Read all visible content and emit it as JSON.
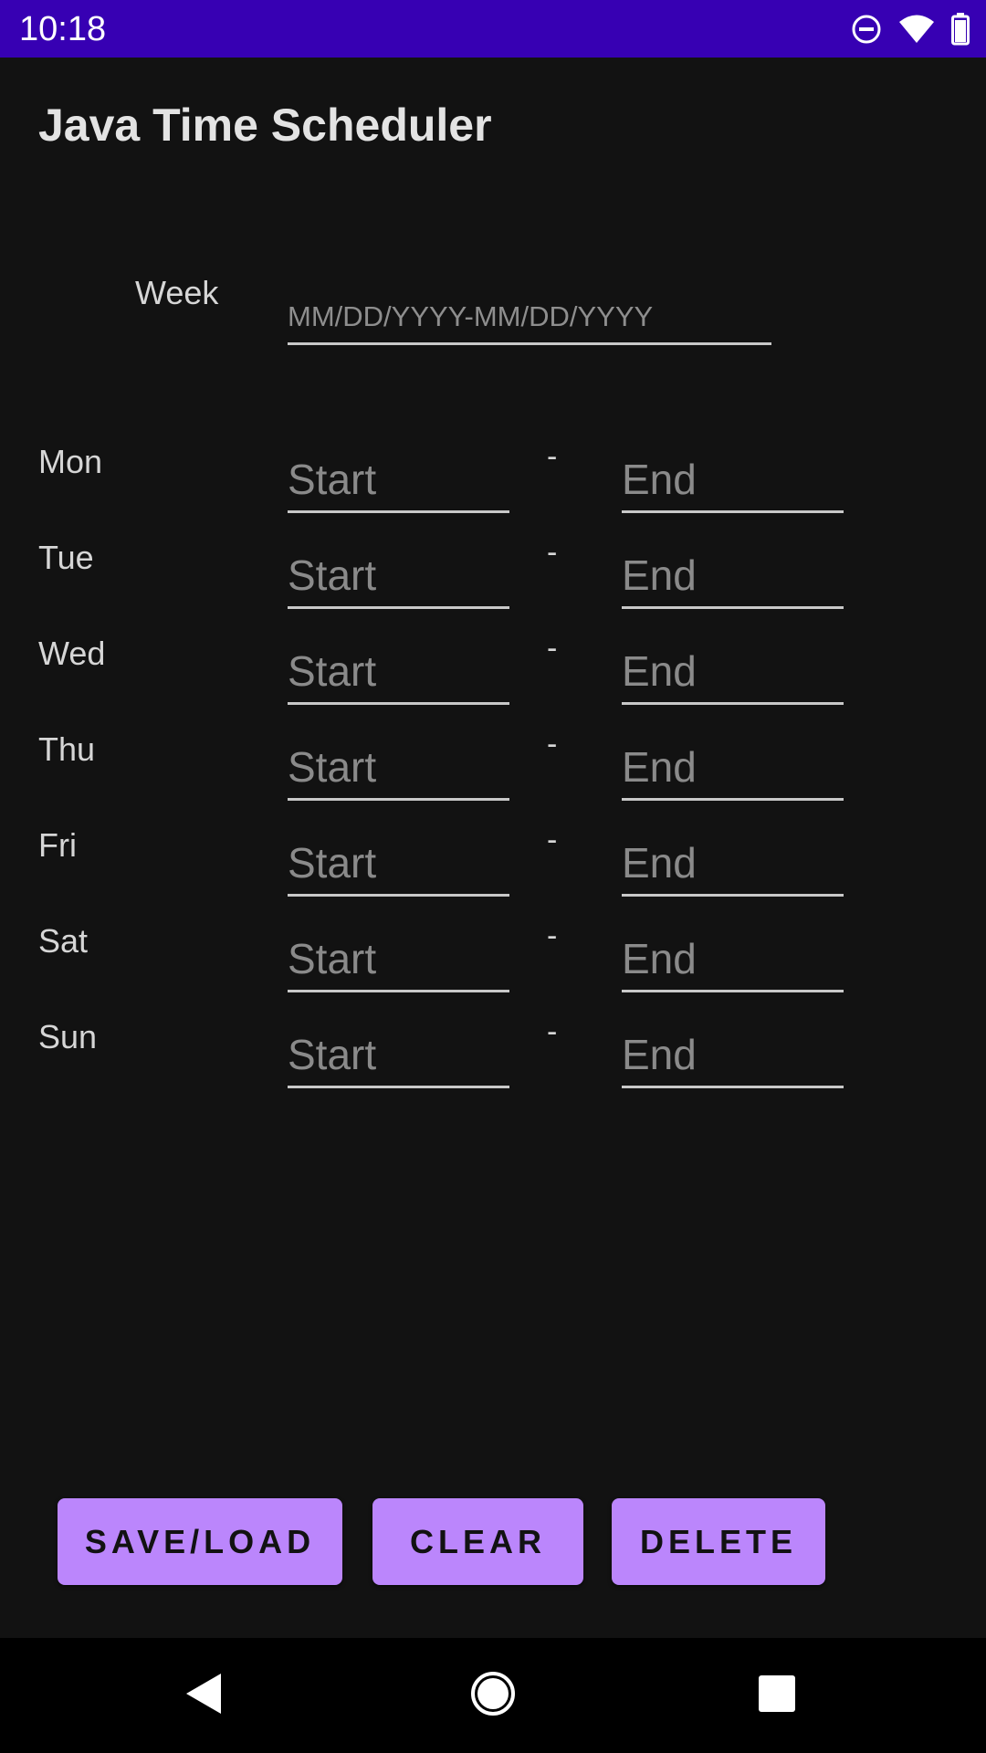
{
  "status_bar": {
    "time": "10:18",
    "icons": [
      "do-not-disturb-icon",
      "wifi-icon",
      "battery-icon"
    ],
    "background": "#3700b3"
  },
  "app": {
    "title": "Java Time Scheduler"
  },
  "week": {
    "label": "Week",
    "value": "",
    "placeholder": "MM/DD/YYYY-MM/DD/YYYY"
  },
  "days": [
    {
      "label": "Mon",
      "start_placeholder": "Start",
      "separator": "-",
      "end_placeholder": "End"
    },
    {
      "label": "Tue",
      "start_placeholder": "Start",
      "separator": "-",
      "end_placeholder": "End"
    },
    {
      "label": "Wed",
      "start_placeholder": "Start",
      "separator": "-",
      "end_placeholder": "End"
    },
    {
      "label": "Thu",
      "start_placeholder": "Start",
      "separator": "-",
      "end_placeholder": "End"
    },
    {
      "label": "Fri",
      "start_placeholder": "Start",
      "separator": "-",
      "end_placeholder": "End"
    },
    {
      "label": "Sat",
      "start_placeholder": "Start",
      "separator": "-",
      "end_placeholder": "End"
    },
    {
      "label": "Sun",
      "start_placeholder": "Start",
      "separator": "-",
      "end_placeholder": "End"
    }
  ],
  "buttons": {
    "save_load": "SAVE/LOAD",
    "clear": "CLEAR",
    "delete": "DELETE",
    "color": "#bb86fc"
  },
  "nav_bar": {
    "icons": [
      "back-icon",
      "home-icon",
      "recents-icon"
    ]
  }
}
